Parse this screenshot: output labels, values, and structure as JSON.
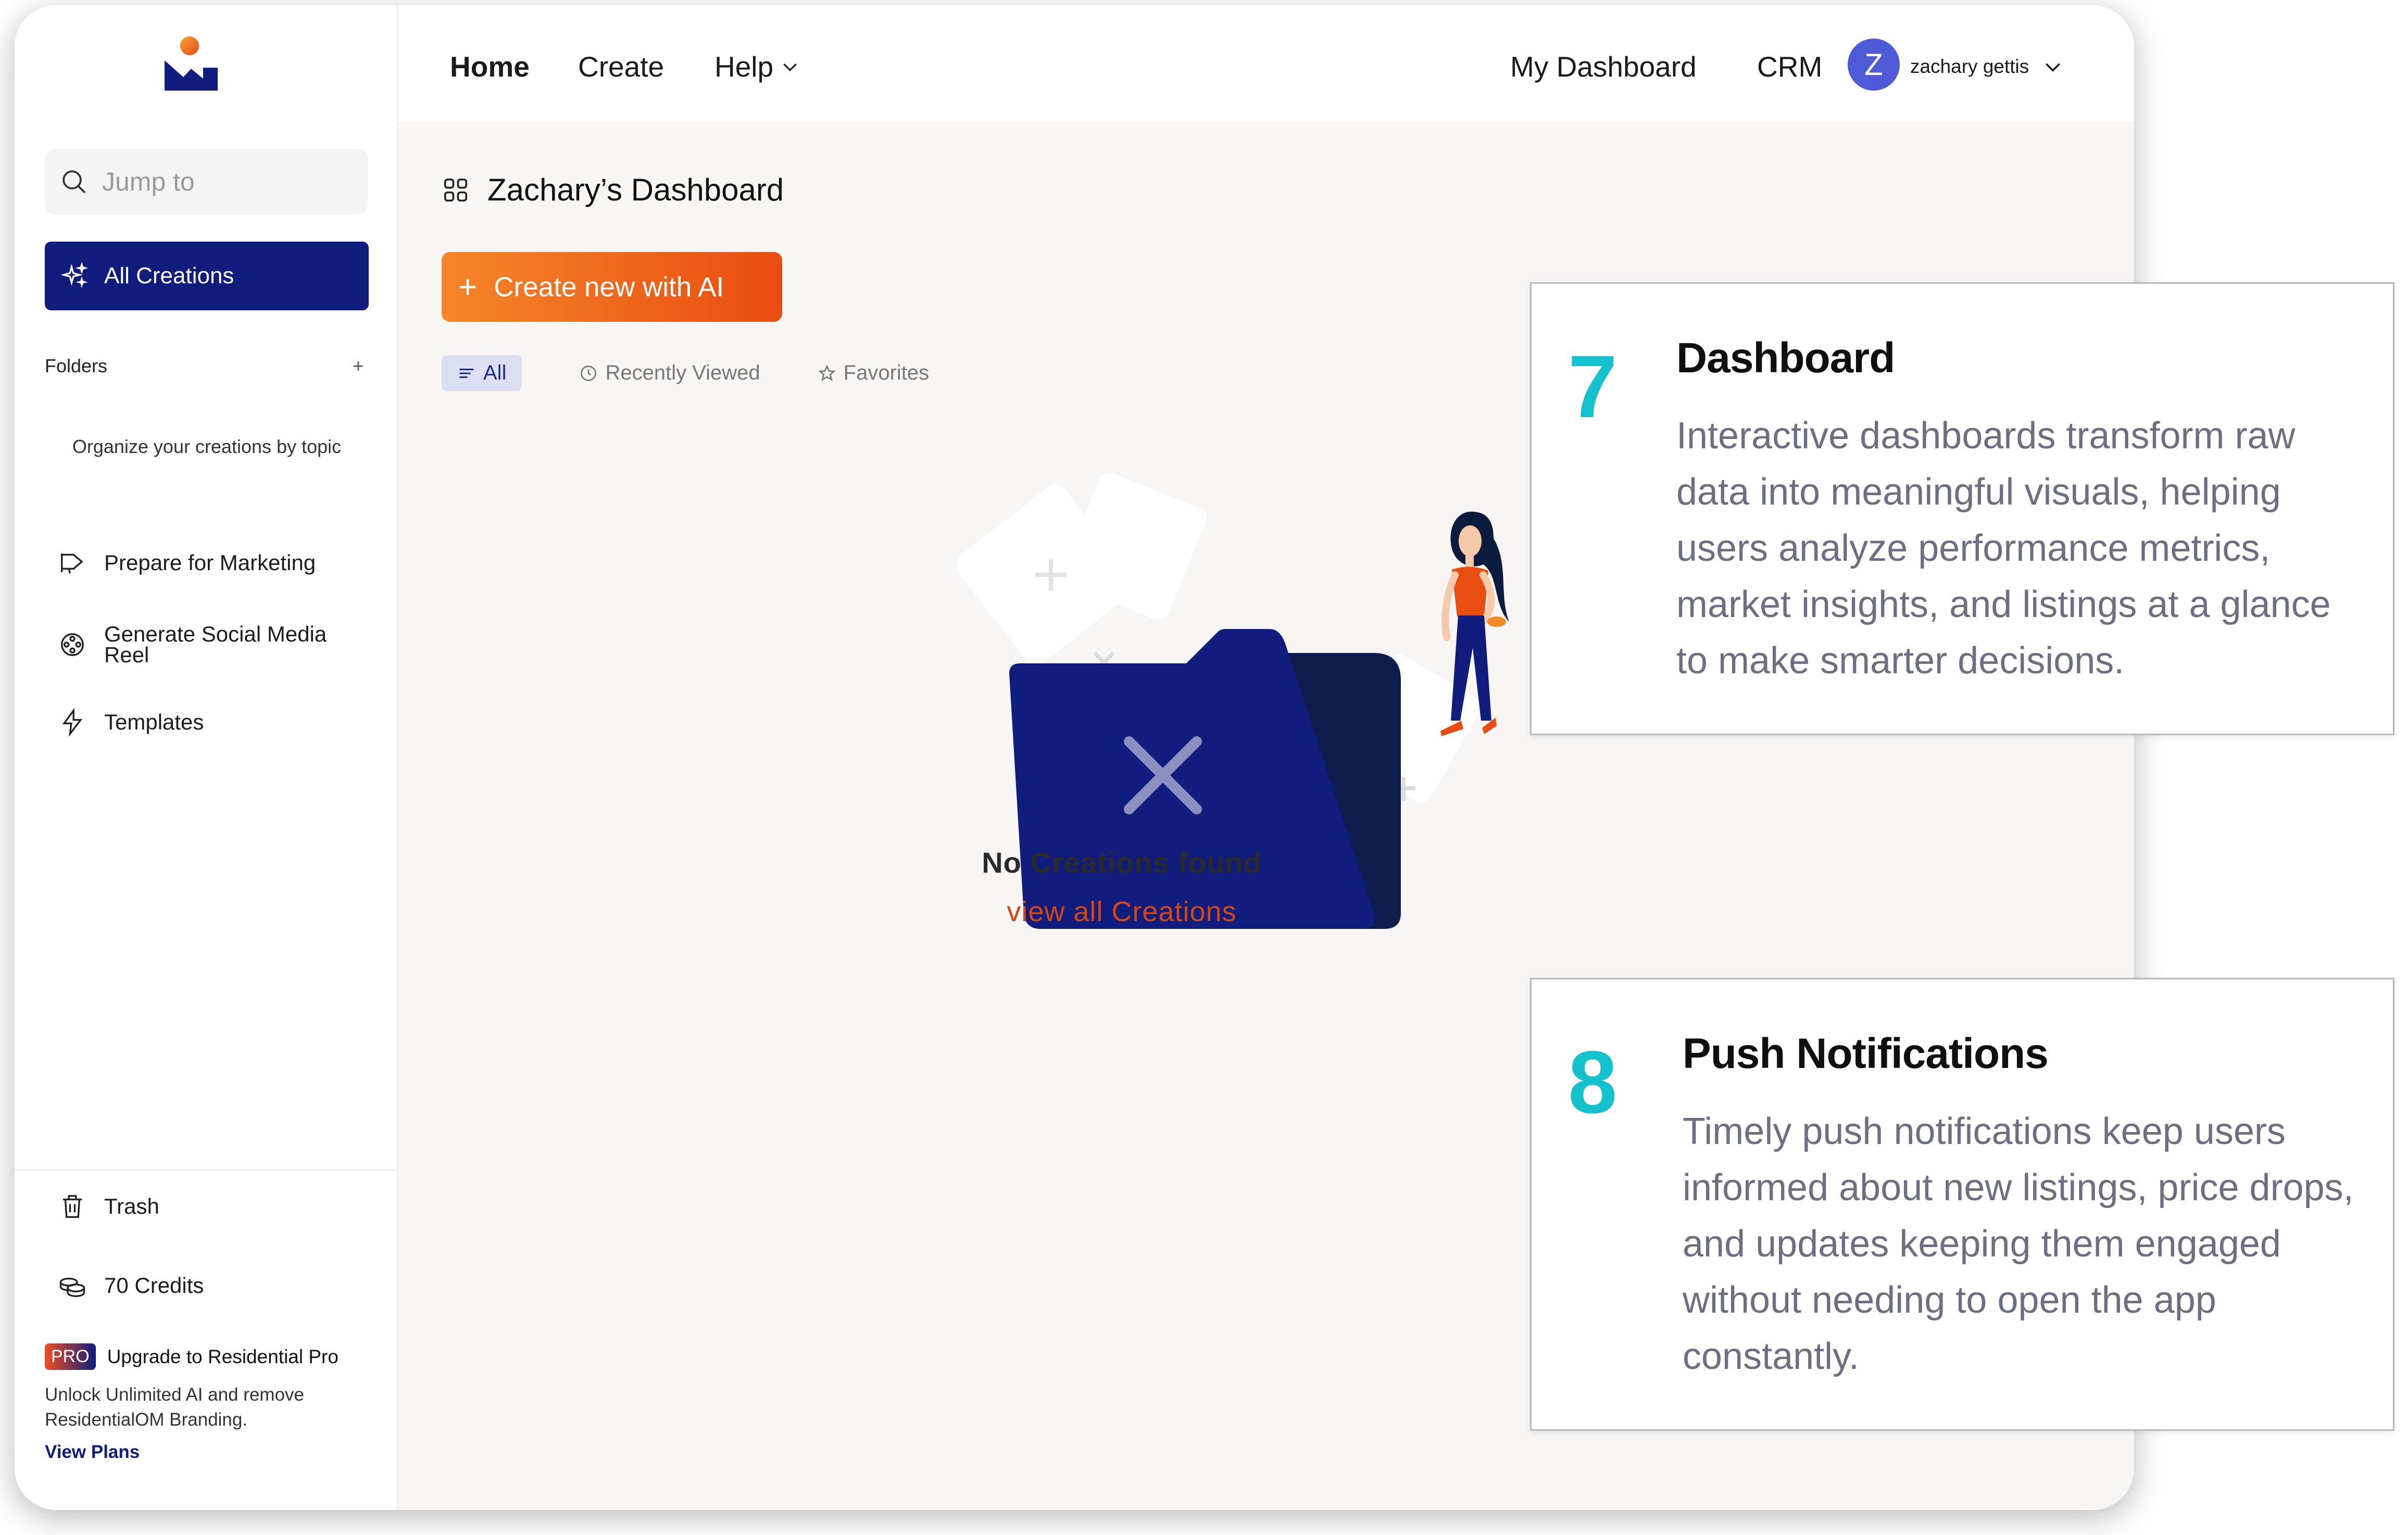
{
  "colors": {
    "brand_navy": "#101d7c",
    "accent_orange": "#e94d10",
    "callout_number": "#13c2cc",
    "avatar": "#4f5ad6"
  },
  "sidebar": {
    "search_placeholder": "Jump to",
    "all_creations_label": "All Creations",
    "folders_label": "Folders",
    "organize_text": "Organize your creations by topic",
    "items": [
      {
        "label": "Prepare for Marketing",
        "icon": "megaphone-icon"
      },
      {
        "label": "Generate Social Media Reel",
        "icon": "film-reel-icon"
      },
      {
        "label": "Templates",
        "icon": "lightning-icon"
      }
    ],
    "trash_label": "Trash",
    "credits_label": "70 Credits",
    "upgrade": {
      "badge": "PRO",
      "title": "Upgrade to Residential Pro",
      "description": "Unlock Unlimited AI and remove ResidentialOM Branding.",
      "link": "View Plans"
    }
  },
  "topnav": {
    "home": "Home",
    "create": "Create",
    "help": "Help",
    "my_dashboard": "My Dashboard",
    "crm": "CRM",
    "avatar_initial": "Z",
    "user_name": "zachary gettis"
  },
  "main": {
    "title": "Zachary’s Dashboard",
    "create_button": "Create new with AI",
    "tabs": [
      {
        "label": "All",
        "icon": "list-icon"
      },
      {
        "label": "Recently Viewed",
        "icon": "clock-icon"
      },
      {
        "label": "Favorites",
        "icon": "star-icon"
      }
    ],
    "empty_title": "No Creations found",
    "empty_link": "view all Creations"
  },
  "callouts": [
    {
      "number": "7",
      "title": "Dashboard",
      "description": "Interactive dashboards transform raw data into meaningful visuals, helping users analyze performance metrics, market insights, and listings at a glance to make smarter decisions."
    },
    {
      "number": "8",
      "title": "Push Notifications",
      "description": "Timely push notifications keep users informed about new listings, price drops, and updates keeping them engaged without needing to open the app constantly."
    }
  ]
}
